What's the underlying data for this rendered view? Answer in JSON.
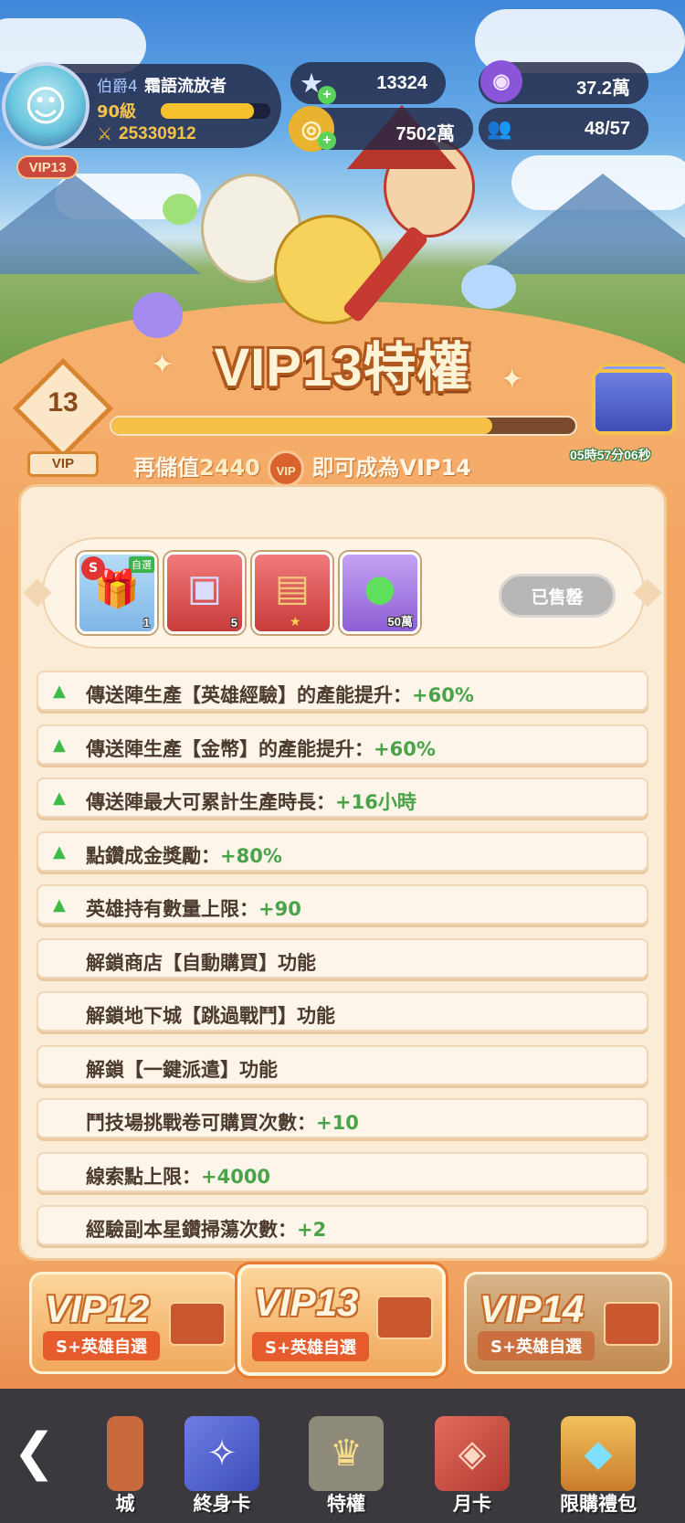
{
  "player": {
    "rank": "伯爵4",
    "name": "霜語流放者",
    "level": "90級",
    "level_progress": 0.85,
    "power": "25330912",
    "vip_badge": "VIP13"
  },
  "resources": {
    "gems": "13324",
    "purple": "37.2萬",
    "gold": "7502萬",
    "heroes": "48/57"
  },
  "title": "VIP13特權",
  "vip_progress": {
    "level": "13",
    "vip_label": "VIP",
    "fill": 0.82,
    "prefix": "再儲值",
    "amount": "2440",
    "coin_label": "VIP",
    "suffix": "即可成為VIP14"
  },
  "chest_timer": "05時57分06秒",
  "rewards": [
    {
      "name": "S+英雄自選寶箱",
      "qty": "1",
      "tag": "自選",
      "badge": "S"
    },
    {
      "name": "召喚卷",
      "qty": "5"
    },
    {
      "name": "卡牌",
      "qty": ""
    },
    {
      "name": "藥水",
      "qty": "50萬"
    }
  ],
  "sold_label": "已售罄",
  "perks": [
    {
      "text": "傳送陣生產【英雄經驗】的產能提升：",
      "value": "+60%",
      "arrow": true
    },
    {
      "text": "傳送陣生產【金幣】的產能提升：",
      "value": "+60%",
      "arrow": true
    },
    {
      "text": "傳送陣最大可累計生產時長：",
      "value": "+16小時",
      "arrow": true
    },
    {
      "text": "點鑽成金獎勵：",
      "value": "+80%",
      "arrow": true
    },
    {
      "text": "英雄持有數量上限：",
      "value": "+90",
      "arrow": true
    },
    {
      "text": "解鎖商店【自動購買】功能",
      "value": "",
      "arrow": false
    },
    {
      "text": "解鎖地下城【跳過戰鬥】功能",
      "value": "",
      "arrow": false
    },
    {
      "text": "解鎖【一鍵派遣】功能",
      "value": "",
      "arrow": false
    },
    {
      "text": "鬥技場挑戰卷可購買次數：",
      "value": "+10",
      "arrow": false
    },
    {
      "text": "線索點上限：",
      "value": "+4000",
      "arrow": false
    },
    {
      "text": "經驗副本星鑽掃蕩次數：",
      "value": "+2",
      "arrow": false
    }
  ],
  "vip_tabs": [
    {
      "label": "VIP12",
      "sub": "S+英雄自選"
    },
    {
      "label": "VIP13",
      "sub": "S+英雄自選"
    },
    {
      "label": "VIP14",
      "sub": "S+英雄自選"
    }
  ],
  "nav": [
    {
      "label": "城",
      "icon": "shop-icon"
    },
    {
      "label": "終身卡",
      "icon": "lifetime-card-icon"
    },
    {
      "label": "特權",
      "icon": "crown-icon"
    },
    {
      "label": "月卡",
      "icon": "monthly-card-icon"
    },
    {
      "label": "限購禮包",
      "icon": "treasure-chest-icon"
    }
  ],
  "colors": {
    "accent": "#f4c046",
    "perk_value": "#4aa349",
    "body": "#f4a766",
    "nav_bg": "#3b383e"
  }
}
